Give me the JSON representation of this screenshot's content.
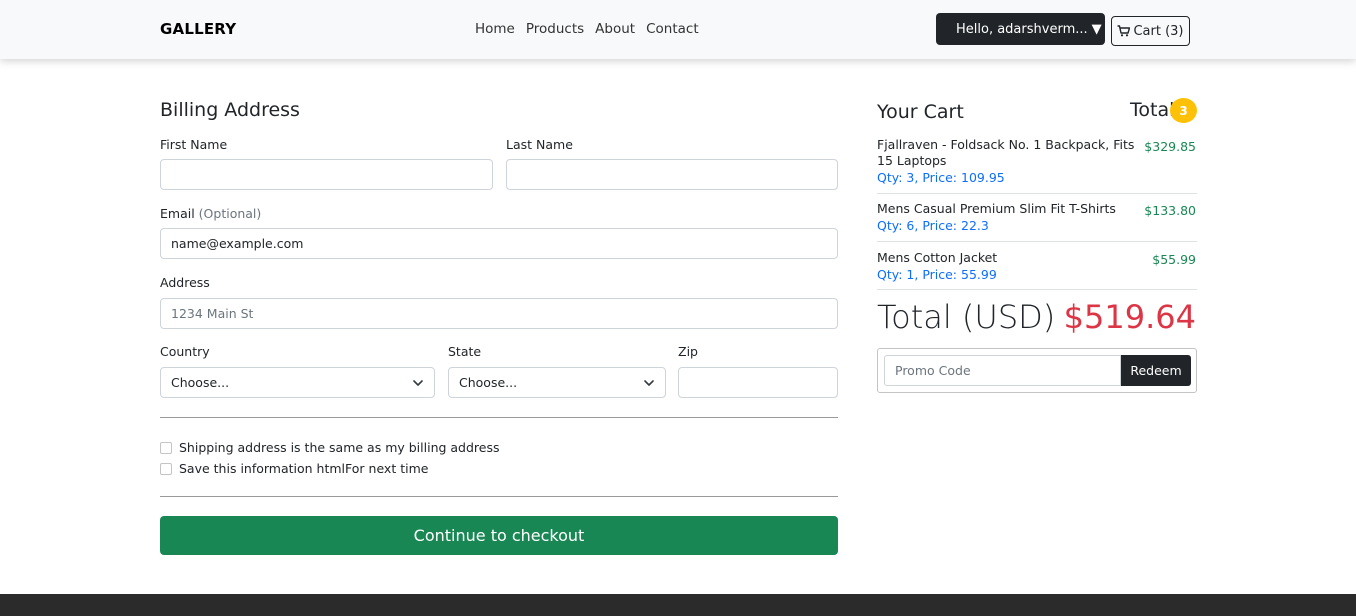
{
  "navbar": {
    "brand": "GALLERY",
    "links": [
      "Home",
      "Products",
      "About",
      "Contact"
    ],
    "user_label": "Hello, adarshverm...",
    "user_caret": "▼",
    "cart_label": "Cart (3)"
  },
  "billing": {
    "title": "Billing Address",
    "first_name": {
      "label": "First Name",
      "value": ""
    },
    "last_name": {
      "label": "Last Name",
      "value": ""
    },
    "email": {
      "label": "Email",
      "optional": "(Optional)",
      "value": "name@example.com"
    },
    "address": {
      "label": "Address",
      "placeholder": "1234 Main St"
    },
    "country": {
      "label": "Country",
      "selected": "Choose..."
    },
    "state": {
      "label": "State",
      "selected": "Choose..."
    },
    "zip": {
      "label": "Zip",
      "value": ""
    },
    "same_address_label": "Shipping address is the same as my billing address",
    "save_info_label": "Save this information htmlFor next time",
    "checkout_label": "Continue to checkout"
  },
  "cart": {
    "heading": "Your Cart",
    "total_word": "Total",
    "count": "3",
    "items": [
      {
        "name": "Fjallraven - Foldsack No. 1 Backpack, Fits 15 Laptops",
        "qty_price": "Qty: 3, Price: 109.95",
        "total": "$329.85"
      },
      {
        "name": "Mens Casual Premium Slim Fit T-Shirts",
        "qty_price": "Qty: 6, Price: 22.3",
        "total": "$133.80"
      },
      {
        "name": "Mens Cotton Jacket",
        "qty_price": "Qty: 1, Price: 55.99",
        "total": "$55.99"
      }
    ],
    "grand_total_label": "Total (USD)",
    "grand_total_value": "$519.64",
    "promo_placeholder": "Promo Code",
    "redeem_label": "Redeem"
  },
  "colors": {
    "success": "#198754",
    "danger": "#dc3545",
    "primary": "#0d6efd",
    "warning": "#ffc107",
    "dark": "#212529"
  },
  "icons": {
    "cart": "shopping-cart-icon",
    "select": "chevron-down-icon"
  }
}
